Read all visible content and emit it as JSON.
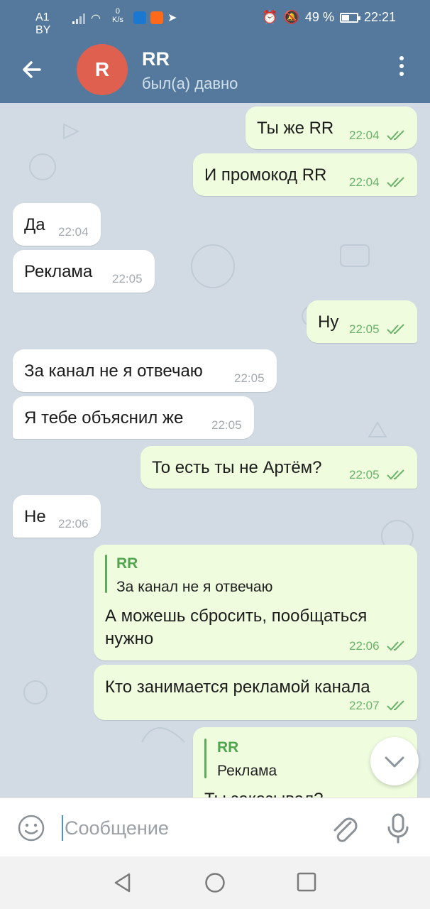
{
  "status_bar": {
    "carrier": "A1 BY",
    "speed_value": "0",
    "speed_unit": "K/s",
    "battery": "49 %",
    "battery_level": 0.49,
    "time": "22:21"
  },
  "header": {
    "avatar_letter": "R",
    "avatar_color": "#e0604f",
    "name": "RR",
    "status": "был(а) давно"
  },
  "messages": [
    {
      "dir": "out",
      "text": "Ты же RR",
      "time": "22:04"
    },
    {
      "dir": "out",
      "text": "И промокод RR",
      "time": "22:04"
    },
    {
      "dir": "in",
      "text": "Да",
      "time": "22:04"
    },
    {
      "dir": "in",
      "text": "Реклама",
      "time": "22:05"
    },
    {
      "dir": "out",
      "text": "Ну",
      "time": "22:05"
    },
    {
      "dir": "in",
      "text": "За канал не я отвечаю",
      "time": "22:05"
    },
    {
      "dir": "in",
      "text": "Я тебе объяснил же",
      "time": "22:05"
    },
    {
      "dir": "out",
      "text": "То есть ты не Артём?",
      "time": "22:05"
    },
    {
      "dir": "in",
      "text": "Не",
      "time": "22:06"
    },
    {
      "dir": "out",
      "reply_name": "RR",
      "reply_text": "За канал не я отвечаю",
      "text_line1": "А можешь сбросить, пообщаться",
      "text_line2": "нужно",
      "time": "22:06"
    },
    {
      "dir": "out",
      "text": "Кто занимается рекламой канала",
      "time": "22:07"
    },
    {
      "dir": "out",
      "reply_name": "RR",
      "reply_text": "Реклама",
      "text": "Ты заказывал?"
    }
  ],
  "input": {
    "placeholder": "Сообщение"
  },
  "icons": {
    "back": "arrow-left-icon",
    "menu": "more-vertical-icon",
    "emoji": "smile-icon",
    "attach": "paperclip-icon",
    "mic": "microphone-icon",
    "scroll": "chevron-down-icon"
  },
  "colors": {
    "header": "#54799c",
    "incoming_bubble": "#ffffff",
    "outgoing_bubble": "#effdde",
    "outgoing_time": "#6ab269",
    "accent_green": "#4fa64f"
  }
}
